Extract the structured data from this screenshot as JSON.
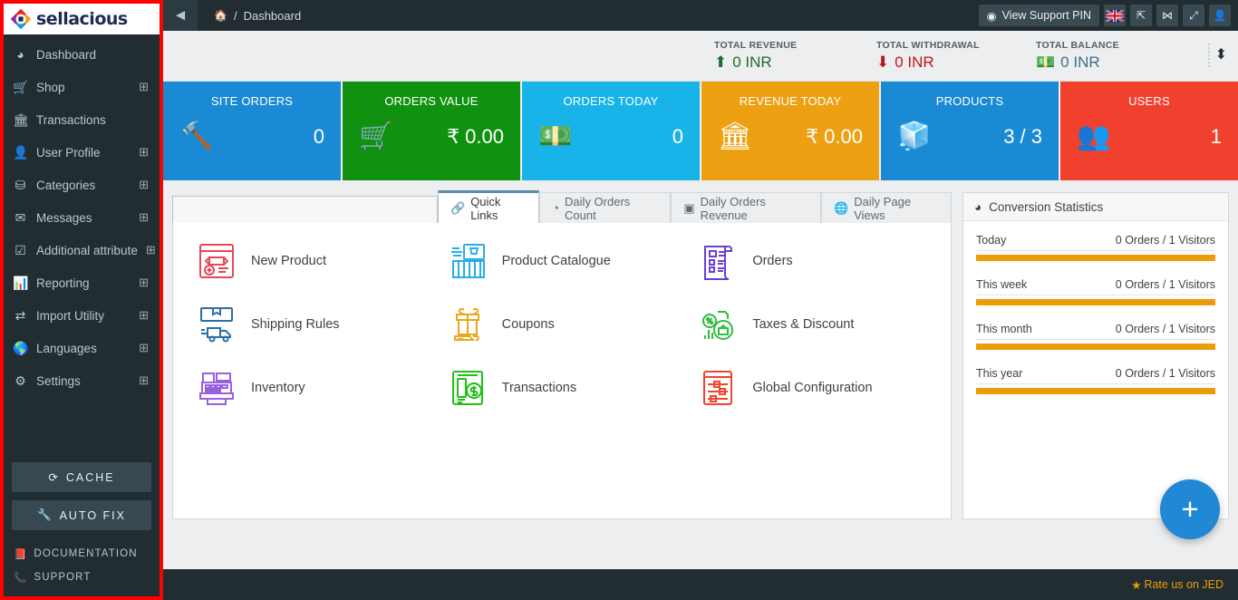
{
  "brand": {
    "name": "sellacious",
    "logo_icon": "diamond-logo-icon"
  },
  "sidebar": {
    "items": [
      {
        "label": "Dashboard",
        "icon": "dashboard-icon",
        "expandable": false
      },
      {
        "label": "Shop",
        "icon": "cart-icon",
        "expandable": true
      },
      {
        "label": "Transactions",
        "icon": "bank-icon",
        "expandable": false
      },
      {
        "label": "User Profile",
        "icon": "user-icon",
        "expandable": true
      },
      {
        "label": "Categories",
        "icon": "sitemap-icon",
        "expandable": true
      },
      {
        "label": "Messages",
        "icon": "envelope-icon",
        "expandable": true
      },
      {
        "label": "Additional attribute",
        "icon": "checkbox-icon",
        "expandable": true
      },
      {
        "label": "Reporting",
        "icon": "bar-chart-icon",
        "expandable": true
      },
      {
        "label": "Import Utility",
        "icon": "exchange-icon",
        "expandable": true
      },
      {
        "label": "Languages",
        "icon": "globe-icon",
        "expandable": true
      },
      {
        "label": "Settings",
        "icon": "gear-icon",
        "expandable": true
      }
    ],
    "plus_glyph": "⊞",
    "buttons": [
      {
        "label": "CACHE",
        "icon": "refresh-icon"
      },
      {
        "label": "AUTO FIX",
        "icon": "wrench-icon"
      }
    ],
    "links": [
      {
        "label": "DOCUMENTATION",
        "icon": "book-icon"
      },
      {
        "label": "SUPPORT",
        "icon": "phone-icon"
      }
    ]
  },
  "header": {
    "back_icon": "arrow-circle-left-icon",
    "home_icon": "home-icon",
    "separator": "/",
    "breadcrumb": "Dashboard",
    "support_pin_label": "View Support PIN",
    "support_pin_icon": "life-ring-icon",
    "actions": [
      {
        "icon": "flag-uk-icon",
        "name": "language-flag"
      },
      {
        "icon": "external-link-icon",
        "name": "preview-site"
      },
      {
        "icon": "joomla-icon",
        "name": "joomla-admin"
      },
      {
        "icon": "expand-icon",
        "name": "fullscreen-toggle"
      },
      {
        "icon": "user-icon",
        "name": "account-menu"
      }
    ]
  },
  "totals": [
    {
      "label": "TOTAL REVENUE",
      "value": "0 INR",
      "icon": "arrow-up-circle-icon",
      "color": "#1f6b2e"
    },
    {
      "label": "TOTAL WITHDRAWAL",
      "value": "0 INR",
      "icon": "arrow-down-circle-icon",
      "color": "#c0151c"
    },
    {
      "label": "TOTAL BALANCE",
      "value": "0 INR",
      "icon": "money-note-icon",
      "color": "#3f6e8c"
    }
  ],
  "sorter_icon": "sort-arrows-icon",
  "kpis": [
    {
      "title": "SITE ORDERS",
      "value": "0",
      "icon": "gavel-icon",
      "color": "#1a8ad5"
    },
    {
      "title": "ORDERS VALUE",
      "value": "₹ 0.00",
      "icon": "cart-down-icon",
      "color": "#109110"
    },
    {
      "title": "ORDERS TODAY",
      "value": "0",
      "icon": "money-note-icon",
      "color": "#18b3e8"
    },
    {
      "title": "REVENUE TODAY",
      "value": "₹ 0.00",
      "icon": "bank-icon",
      "color": "#eda012"
    },
    {
      "title": "PRODUCTS",
      "value": "3 / 3",
      "icon": "cubes-icon",
      "color": "#1a8ad5"
    },
    {
      "title": "USERS",
      "value": "1",
      "icon": "users-icon",
      "color": "#f2402f"
    }
  ],
  "tabs": [
    {
      "label": "Quick Links",
      "icon": "link-icon",
      "active": true
    },
    {
      "label": "Daily Orders Count",
      "icon": "clock-icon",
      "active": false
    },
    {
      "label": "Daily Orders Revenue",
      "icon": "money-icon",
      "active": false
    },
    {
      "label": "Daily Page Views",
      "icon": "globe-icon",
      "active": false
    }
  ],
  "quick_links": [
    {
      "label": "New Product",
      "icon": "new-product-icon",
      "color": "#e8475a"
    },
    {
      "label": "Product Catalogue",
      "icon": "product-catalogue-icon",
      "color": "#29aee4"
    },
    {
      "label": "Orders",
      "icon": "orders-scroll-icon",
      "color": "#6b3fd4"
    },
    {
      "label": "Shipping Rules",
      "icon": "shipping-truck-icon",
      "color": "#2c6fa8"
    },
    {
      "label": "Coupons",
      "icon": "coupon-gift-icon",
      "color": "#e8a91c"
    },
    {
      "label": "Taxes & Discount",
      "icon": "taxes-discount-icon",
      "color": "#2fbd3f"
    },
    {
      "label": "Inventory",
      "icon": "inventory-register-icon",
      "color": "#9a5fe0"
    },
    {
      "label": "Transactions",
      "icon": "transactions-mobile-icon",
      "color": "#1fc018"
    },
    {
      "label": "Global Configuration",
      "icon": "sliders-config-icon",
      "color": "#f0442c"
    }
  ],
  "conversion": {
    "title": "Conversion Statistics",
    "icon": "pie-chart-icon",
    "bar_color": "#eb9c06",
    "rows": [
      {
        "label": "Today",
        "value": "0 Orders / 1 Visitors",
        "percent": 100
      },
      {
        "label": "This week",
        "value": "0 Orders / 1 Visitors",
        "percent": 100
      },
      {
        "label": "This month",
        "value": "0 Orders / 1 Visitors",
        "percent": 100
      },
      {
        "label": "This year",
        "value": "0 Orders / 1 Visitors",
        "percent": 100
      }
    ]
  },
  "fab": {
    "icon": "plus-icon",
    "label": "+"
  },
  "footer": {
    "left_text": "",
    "jed_label": "Rate us on JED",
    "jed_icon": "star-icon"
  }
}
